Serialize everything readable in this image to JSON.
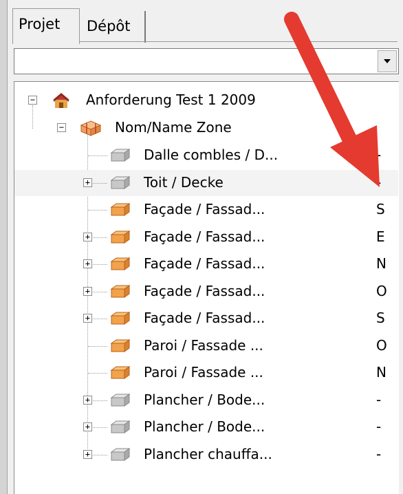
{
  "tabs": [
    {
      "label": "Projet",
      "active": true
    },
    {
      "label": "Dépôt",
      "active": false
    }
  ],
  "combo": {
    "value": "",
    "button_icon": "chevron-down-icon"
  },
  "tree": {
    "root": {
      "label": "Anforderung Test 1 2009",
      "expanded": true,
      "icon": "house-icon"
    },
    "zone": {
      "label": "Nom/Name Zone",
      "expanded": true,
      "icon": "zone-icon"
    },
    "items": [
      {
        "label": "Dalle combles / D...",
        "suffix": "-",
        "has_children": false,
        "icon": "element-gray-icon"
      },
      {
        "label": "Toit / Decke",
        "suffix": "-",
        "has_children": true,
        "icon": "element-gray-icon"
      },
      {
        "label": "Façade / Fassad...",
        "suffix": "S",
        "has_children": false,
        "icon": "element-orange-icon"
      },
      {
        "label": "Façade / Fassad...",
        "suffix": "E",
        "has_children": true,
        "icon": "element-orange-icon"
      },
      {
        "label": "Façade / Fassad...",
        "suffix": "N",
        "has_children": true,
        "icon": "element-orange-icon"
      },
      {
        "label": "Façade / Fassad...",
        "suffix": "O",
        "has_children": true,
        "icon": "element-orange-icon"
      },
      {
        "label": "Façade / Fassad...",
        "suffix": "S",
        "has_children": true,
        "icon": "element-orange-icon"
      },
      {
        "label": "Paroi / Fassade ...",
        "suffix": "O",
        "has_children": false,
        "icon": "element-orange-icon"
      },
      {
        "label": "Paroi / Fassade ...",
        "suffix": "N",
        "has_children": false,
        "icon": "element-orange-icon"
      },
      {
        "label": "Plancher / Bode...",
        "suffix": "-",
        "has_children": true,
        "icon": "element-gray-icon"
      },
      {
        "label": "Plancher / Bode...",
        "suffix": "-",
        "has_children": true,
        "icon": "element-gray-icon"
      },
      {
        "label": "Plancher chauffa...",
        "suffix": "-",
        "has_children": true,
        "icon": "element-gray-icon"
      }
    ]
  },
  "colors": {
    "arrow": "#e53a2f",
    "orange_block": "#f2a24a",
    "gray_block": "#c8c8c8"
  }
}
